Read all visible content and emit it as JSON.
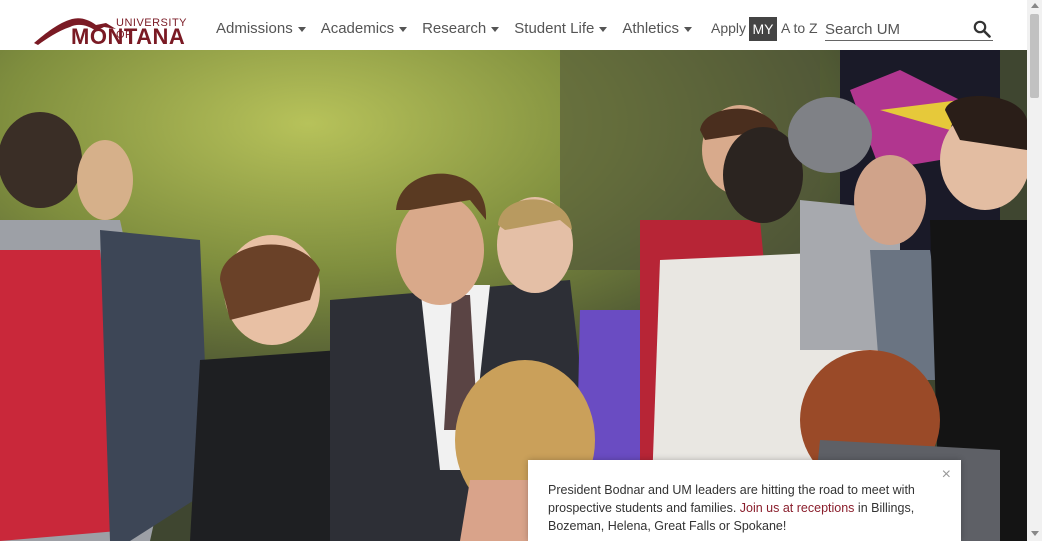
{
  "brand": {
    "line1": "UNIVERSITY OF",
    "line2": "MONTANA",
    "color": "#7a1a24"
  },
  "nav": {
    "items": [
      {
        "label": "Admissions"
      },
      {
        "label": "Academics"
      },
      {
        "label": "Research"
      },
      {
        "label": "Student Life"
      },
      {
        "label": "Athletics"
      }
    ]
  },
  "utility": {
    "apply": "Apply",
    "my": "MY",
    "atoz": "A to Z"
  },
  "search": {
    "placeholder": "Search UM",
    "icon": "search-icon"
  },
  "alert": {
    "text_before": "President Bodnar and UM leaders are hitting the road to meet with prospective students and families. ",
    "link": "Join us at receptions",
    "text_after": " in Billings, Bozeman, Helena, Great Falls or Spokane!",
    "close": "×"
  },
  "colors": {
    "accent": "#7a1a24",
    "link": "#8a1e2c",
    "my_bg": "#444444"
  }
}
